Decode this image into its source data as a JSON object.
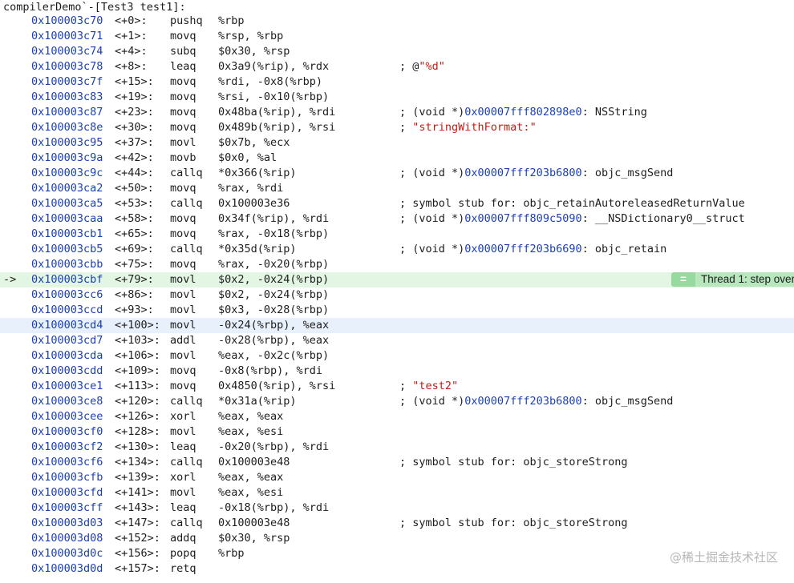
{
  "header": "compilerDemo`-[Test3 test1]:",
  "current_arrow": "->",
  "thread_badge": {
    "icon": "=",
    "text": "Thread 1: step over"
  },
  "watermark": "@稀土掘金技术社区",
  "rows": [
    {
      "addr": "0x100003c70",
      "off": "<+0>:",
      "op": "pushq",
      "args": "%rbp"
    },
    {
      "addr": "0x100003c71",
      "off": "<+1>:",
      "op": "movq",
      "args": "%rsp, %rbp"
    },
    {
      "addr": "0x100003c74",
      "off": "<+4>:",
      "op": "subq",
      "args": "$0x30, %rsp"
    },
    {
      "addr": "0x100003c78",
      "off": "<+8>:",
      "op": "leaq",
      "args": "0x3a9(%rip), %rdx",
      "c1": "; @",
      "c2": "\"%d\"",
      "c3": ""
    },
    {
      "addr": "0x100003c7f",
      "off": "<+15>:",
      "op": "movq",
      "args": "%rdi, -0x8(%rbp)"
    },
    {
      "addr": "0x100003c83",
      "off": "<+19>:",
      "op": "movq",
      "args": "%rsi, -0x10(%rbp)"
    },
    {
      "addr": "0x100003c87",
      "off": "<+23>:",
      "op": "movq",
      "args": "0x48ba(%rip), %rdi",
      "c1": "; (void *)",
      "p": "0x00007fff802898e0",
      "c3": ": NSString"
    },
    {
      "addr": "0x100003c8e",
      "off": "<+30>:",
      "op": "movq",
      "args": "0x489b(%rip), %rsi",
      "c1": "; ",
      "c2": "\"stringWithFormat:\"",
      "c3": ""
    },
    {
      "addr": "0x100003c95",
      "off": "<+37>:",
      "op": "movl",
      "args": "$0x7b, %ecx"
    },
    {
      "addr": "0x100003c9a",
      "off": "<+42>:",
      "op": "movb",
      "args": "$0x0, %al"
    },
    {
      "addr": "0x100003c9c",
      "off": "<+44>:",
      "op": "callq",
      "args": "*0x366(%rip)",
      "c1": "; (void *)",
      "p": "0x00007fff203b6800",
      "c3": ": objc_msgSend"
    },
    {
      "addr": "0x100003ca2",
      "off": "<+50>:",
      "op": "movq",
      "args": "%rax, %rdi"
    },
    {
      "addr": "0x100003ca5",
      "off": "<+53>:",
      "op": "callq",
      "args": "0x100003e36",
      "c1": "; symbol stub for: objc_retainAutoreleasedReturnValue",
      "c3": ""
    },
    {
      "addr": "0x100003caa",
      "off": "<+58>:",
      "op": "movq",
      "args": "0x34f(%rip), %rdi",
      "c1": "; (void *)",
      "p": "0x00007fff809c5090",
      "c3": ": __NSDictionary0__struct"
    },
    {
      "addr": "0x100003cb1",
      "off": "<+65>:",
      "op": "movq",
      "args": "%rax, -0x18(%rbp)"
    },
    {
      "addr": "0x100003cb5",
      "off": "<+69>:",
      "op": "callq",
      "args": "*0x35d(%rip)",
      "c1": "; (void *)",
      "p": "0x00007fff203b6690",
      "c3": ": objc_retain"
    },
    {
      "addr": "0x100003cbb",
      "off": "<+75>:",
      "op": "movq",
      "args": "%rax, -0x20(%rbp)"
    },
    {
      "addr": "0x100003cbf",
      "off": "<+79>:",
      "op": "movl",
      "args": "$0x2, -0x24(%rbp)",
      "current": true
    },
    {
      "addr": "0x100003cc6",
      "off": "<+86>:",
      "op": "movl",
      "args": "$0x2, -0x24(%rbp)"
    },
    {
      "addr": "0x100003ccd",
      "off": "<+93>:",
      "op": "movl",
      "args": "$0x3, -0x28(%rbp)"
    },
    {
      "addr": "0x100003cd4",
      "off": "<+100>:",
      "op": "movl",
      "args": "-0x24(%rbp), %eax",
      "hover": true
    },
    {
      "addr": "0x100003cd7",
      "off": "<+103>:",
      "op": "addl",
      "args": "-0x28(%rbp), %eax"
    },
    {
      "addr": "0x100003cda",
      "off": "<+106>:",
      "op": "movl",
      "args": "%eax, -0x2c(%rbp)"
    },
    {
      "addr": "0x100003cdd",
      "off": "<+109>:",
      "op": "movq",
      "args": "-0x8(%rbp), %rdi"
    },
    {
      "addr": "0x100003ce1",
      "off": "<+113>:",
      "op": "movq",
      "args": "0x4850(%rip), %rsi",
      "c1": "; ",
      "c2": "\"test2\"",
      "c3": ""
    },
    {
      "addr": "0x100003ce8",
      "off": "<+120>:",
      "op": "callq",
      "args": "*0x31a(%rip)",
      "c1": "; (void *)",
      "p": "0x00007fff203b6800",
      "c3": ": objc_msgSend"
    },
    {
      "addr": "0x100003cee",
      "off": "<+126>:",
      "op": "xorl",
      "args": "%eax, %eax"
    },
    {
      "addr": "0x100003cf0",
      "off": "<+128>:",
      "op": "movl",
      "args": "%eax, %esi"
    },
    {
      "addr": "0x100003cf2",
      "off": "<+130>:",
      "op": "leaq",
      "args": "-0x20(%rbp), %rdi"
    },
    {
      "addr": "0x100003cf6",
      "off": "<+134>:",
      "op": "callq",
      "args": "0x100003e48",
      "c1": "; symbol stub for: objc_storeStrong",
      "c3": ""
    },
    {
      "addr": "0x100003cfb",
      "off": "<+139>:",
      "op": "xorl",
      "args": "%eax, %eax"
    },
    {
      "addr": "0x100003cfd",
      "off": "<+141>:",
      "op": "movl",
      "args": "%eax, %esi"
    },
    {
      "addr": "0x100003cff",
      "off": "<+143>:",
      "op": "leaq",
      "args": "-0x18(%rbp), %rdi"
    },
    {
      "addr": "0x100003d03",
      "off": "<+147>:",
      "op": "callq",
      "args": "0x100003e48",
      "c1": "; symbol stub for: objc_storeStrong",
      "c3": ""
    },
    {
      "addr": "0x100003d08",
      "off": "<+152>:",
      "op": "addq",
      "args": "$0x30, %rsp"
    },
    {
      "addr": "0x100003d0c",
      "off": "<+156>:",
      "op": "popq",
      "args": "%rbp"
    },
    {
      "addr": "0x100003d0d",
      "off": "<+157>:",
      "op": "retq",
      "args": ""
    }
  ]
}
